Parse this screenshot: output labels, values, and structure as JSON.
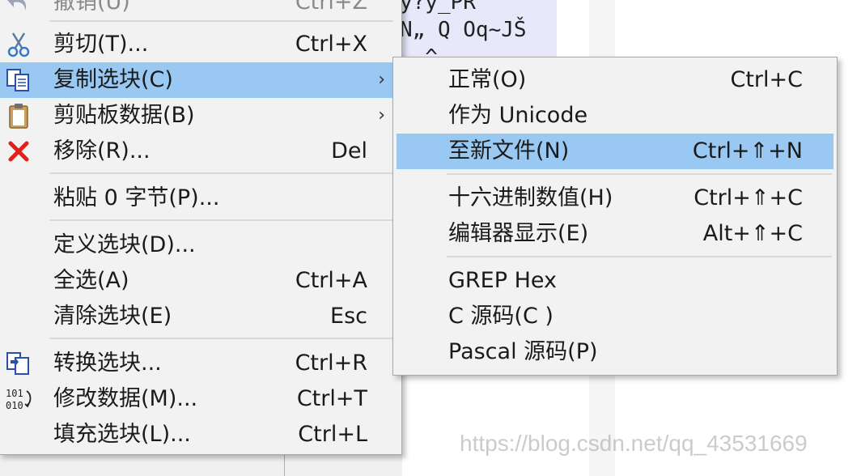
{
  "main_menu": {
    "items": [
      {
        "label": "撤销(U)",
        "shortcut": "Ctrl+Z",
        "icon": "undo-icon",
        "disabled": true
      },
      {
        "label": "剪切(T)...",
        "shortcut": "Ctrl+X",
        "icon": "scissors-icon"
      },
      {
        "label": "复制选块(C)",
        "shortcut": "",
        "icon": "copy-block-icon",
        "submenu": true,
        "highlighted": true
      },
      {
        "label": "剪贴板数据(B)",
        "shortcut": "",
        "icon": "clipboard-icon",
        "submenu": true
      },
      {
        "label": "移除(R)...",
        "shortcut": "Del",
        "icon": "delete-x-icon"
      },
      {
        "label": "粘贴 0 字节(P)...",
        "shortcut": ""
      },
      {
        "label": "定义选块(D)...",
        "shortcut": ""
      },
      {
        "label": "全选(A)",
        "shortcut": "Ctrl+A"
      },
      {
        "label": "清除选块(E)",
        "shortcut": "Esc"
      },
      {
        "label": "转换选块...",
        "shortcut": "Ctrl+R",
        "icon": "convert-block-icon"
      },
      {
        "label": "修改数据(M)...",
        "shortcut": "Ctrl+T",
        "icon": "binary-modify-icon"
      },
      {
        "label": "填充选块(L)...",
        "shortcut": "Ctrl+L"
      }
    ],
    "submenu_arrow": "›"
  },
  "sub_menu": {
    "items": [
      {
        "label": "正常(O)",
        "shortcut": "Ctrl+C"
      },
      {
        "label": "作为 Unicode",
        "shortcut": ""
      },
      {
        "label": "至新文件(N)",
        "shortcut": "Ctrl+⇑+N",
        "highlighted": true
      },
      {
        "label": "十六进制数值(H)",
        "shortcut": "Ctrl+⇑+C"
      },
      {
        "label": "编辑器显示(E)",
        "shortcut": "Alt+⇑+C"
      },
      {
        "label": "GREP Hex",
        "shortcut": ""
      },
      {
        "label": "C 源码(C )",
        "shortcut": ""
      },
      {
        "label": "Pascal 源码(P)",
        "shortcut": ""
      }
    ]
  },
  "background": {
    "hex_lines": [
      "y?y_PR",
      "N„ Q Oq~JŠ",
      " ,^"
    ]
  },
  "watermark": "https://blog.csdn.net/qq_43531669",
  "colors": {
    "highlight": "#99c9f3",
    "menu_bg": "#f2f2f2",
    "delete_red": "#e0201c"
  }
}
